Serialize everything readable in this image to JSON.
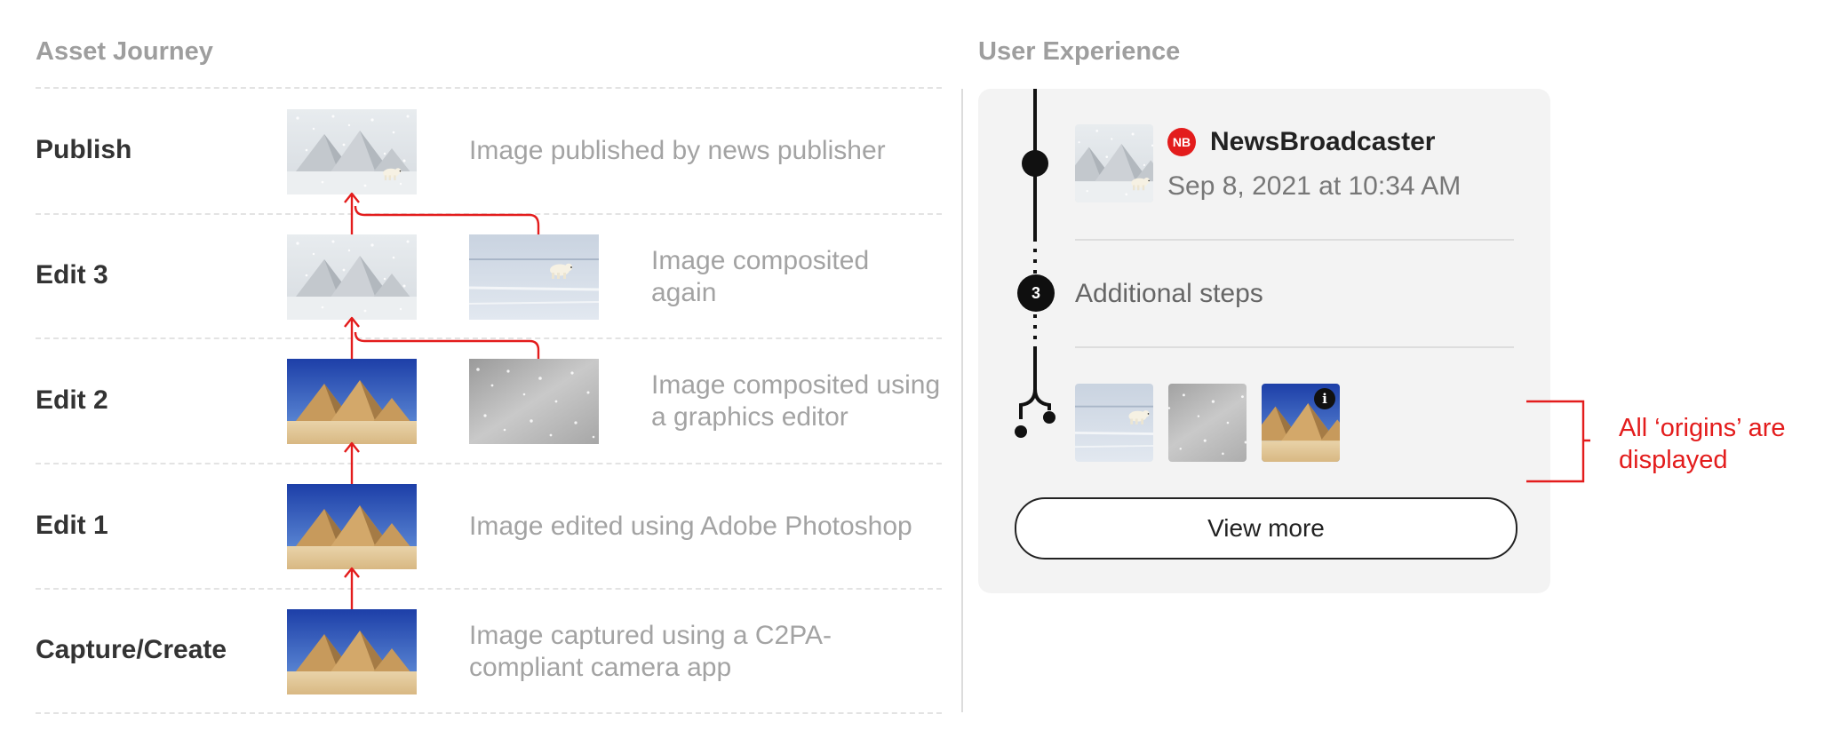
{
  "left": {
    "title": "Asset Journey",
    "stages": [
      {
        "label": "Publish",
        "description": "Image published by news publisher",
        "image": "snow-pyramids-bear",
        "ingredient": null
      },
      {
        "label": "Edit 3",
        "description": "Image composited again",
        "image": "snow-pyramids",
        "ingredient": "polar-bear"
      },
      {
        "label": "Edit 2",
        "description": "Image composited using a graphics editor",
        "image": "pyramids",
        "ingredient": "snowfall"
      },
      {
        "label": "Edit 1",
        "description": "Image edited using Adobe Photoshop",
        "image": "pyramids",
        "ingredient": null
      },
      {
        "label": "Capture/Create",
        "description": "Image captured using a C2PA-compliant camera app",
        "image": "pyramids",
        "ingredient": null
      }
    ]
  },
  "right": {
    "title": "User Experience",
    "publisher": {
      "badge": "NB",
      "name": "NewsBroadcaster",
      "date": "Sep 8, 2021 at 10:34 AM",
      "image": "snow-pyramids-bear"
    },
    "steps": {
      "count": "3",
      "label": "Additional steps"
    },
    "origins": [
      {
        "image": "polar-bear",
        "info_badge": false
      },
      {
        "image": "snowfall",
        "info_badge": false
      },
      {
        "image": "pyramids",
        "info_badge": true
      }
    ],
    "info_badge_glyph": "i",
    "view_more_label": "View more"
  },
  "annotation": {
    "text": "All ‘origins’ are displayed",
    "color": "#e31c1c"
  },
  "colors": {
    "arrow": "#e31c1c",
    "accent": "#e31c1c",
    "card": "#f3f3f3"
  }
}
